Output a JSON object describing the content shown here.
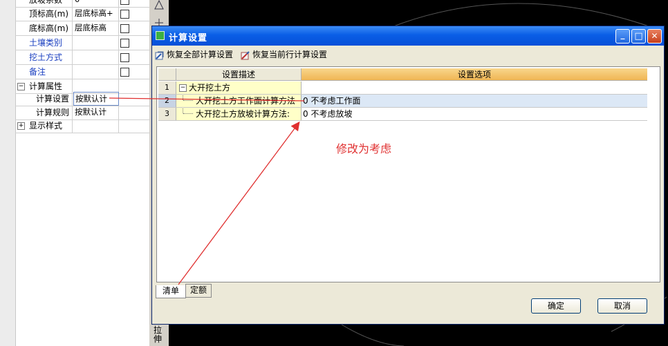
{
  "property_panel": {
    "rows": [
      {
        "label": "放坡系数",
        "value": "0",
        "checkbox": true
      },
      {
        "label": "顶标高(m)",
        "value": "层底标高+",
        "checkbox": true
      },
      {
        "label": "底标高(m)",
        "value": "层底标高",
        "checkbox": true
      },
      {
        "label": "土壤类别",
        "value": "",
        "checkbox": true
      },
      {
        "label": "挖土方式",
        "value": "",
        "checkbox": true
      },
      {
        "label": "备注",
        "value": "",
        "checkbox": true
      },
      {
        "label": "计算属性",
        "value": "",
        "checkbox": false
      },
      {
        "label": "计算设置",
        "value": "按默认计",
        "checkbox": false
      },
      {
        "label": "计算规则",
        "value": "按默认计",
        "checkbox": false
      },
      {
        "label": "显示样式",
        "value": "",
        "checkbox": false
      }
    ],
    "expander_minus": "−",
    "expander_plus": "+"
  },
  "side_toolbar": {
    "vertical_text_1": "拉",
    "vertical_text_2": "伸"
  },
  "dialog": {
    "title": "计算设置",
    "window_buttons": {
      "minimize": "_",
      "maximize": "□",
      "close": "✕"
    },
    "toolbar": {
      "restore_all": "恢复全部计算设置",
      "restore_current": "恢复当前行计算设置"
    },
    "grid": {
      "headers": {
        "desc": "设置描述",
        "option": "设置选项"
      },
      "rows": [
        {
          "num": "1",
          "desc": "大开挖土方",
          "option": ""
        },
        {
          "num": "2",
          "desc": "大开挖土方工作面计算方法",
          "option": "0 不考虑工作面"
        },
        {
          "num": "3",
          "desc": "大开挖土方放坡计算方法:",
          "option": "0 不考虑放坡"
        }
      ]
    },
    "tabs": {
      "qingdan": "清单",
      "dinge": "定额"
    },
    "buttons": {
      "ok": "确定",
      "cancel": "取消"
    }
  },
  "annotation": {
    "text": "修改为考虑",
    "color": "#e03030"
  },
  "colors": {
    "title_bar": "#0a5ee6",
    "option_header": "#f0b654",
    "desc_cell": "#ffffc8",
    "arrow": "#e03030"
  }
}
